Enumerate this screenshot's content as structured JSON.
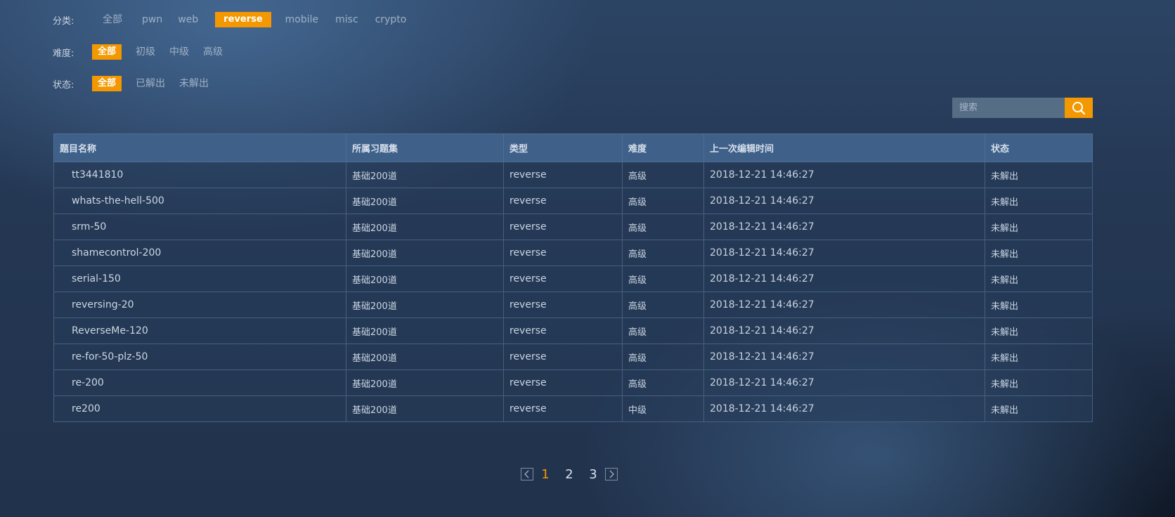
{
  "filters": {
    "category": {
      "label": "分类:",
      "options": [
        "全部",
        "pwn",
        "web",
        "reverse",
        "mobile",
        "misc",
        "crypto"
      ],
      "selected": "reverse"
    },
    "difficulty": {
      "label": "难度:",
      "options": [
        "全部",
        "初级",
        "中级",
        "高级"
      ],
      "selected": "全部"
    },
    "status": {
      "label": "状态:",
      "options": [
        "全部",
        "已解出",
        "未解出"
      ],
      "selected": "全部"
    }
  },
  "search": {
    "placeholder": "搜索",
    "icon": "search-icon"
  },
  "table": {
    "headers": [
      "题目名称",
      "所属习题集",
      "类型",
      "难度",
      "上一次编辑时间",
      "状态"
    ],
    "rows": [
      [
        "tt3441810",
        "基础200道",
        "reverse",
        "高级",
        "2018-12-21 14:46:27",
        "未解出"
      ],
      [
        "whats-the-hell-500",
        "基础200道",
        "reverse",
        "高级",
        "2018-12-21 14:46:27",
        "未解出"
      ],
      [
        "srm-50",
        "基础200道",
        "reverse",
        "高级",
        "2018-12-21 14:46:27",
        "未解出"
      ],
      [
        "shamecontrol-200",
        "基础200道",
        "reverse",
        "高级",
        "2018-12-21 14:46:27",
        "未解出"
      ],
      [
        "serial-150",
        "基础200道",
        "reverse",
        "高级",
        "2018-12-21 14:46:27",
        "未解出"
      ],
      [
        "reversing-20",
        "基础200道",
        "reverse",
        "高级",
        "2018-12-21 14:46:27",
        "未解出"
      ],
      [
        "ReverseMe-120",
        "基础200道",
        "reverse",
        "高级",
        "2018-12-21 14:46:27",
        "未解出"
      ],
      [
        "re-for-50-plz-50",
        "基础200道",
        "reverse",
        "高级",
        "2018-12-21 14:46:27",
        "未解出"
      ],
      [
        "re-200",
        "基础200道",
        "reverse",
        "高级",
        "2018-12-21 14:46:27",
        "未解出"
      ],
      [
        "re200",
        "基础200道",
        "reverse",
        "中级",
        "2018-12-21 14:46:27",
        "未解出"
      ]
    ]
  },
  "pagination": {
    "pages": [
      "1",
      "2",
      "3"
    ],
    "current": "1",
    "prev_icon": "chevron-left-icon",
    "next_icon": "chevron-right-icon"
  },
  "colors": {
    "accent": "#f39800",
    "header_bg": "#3f6089",
    "search_bg": "#566d86"
  }
}
